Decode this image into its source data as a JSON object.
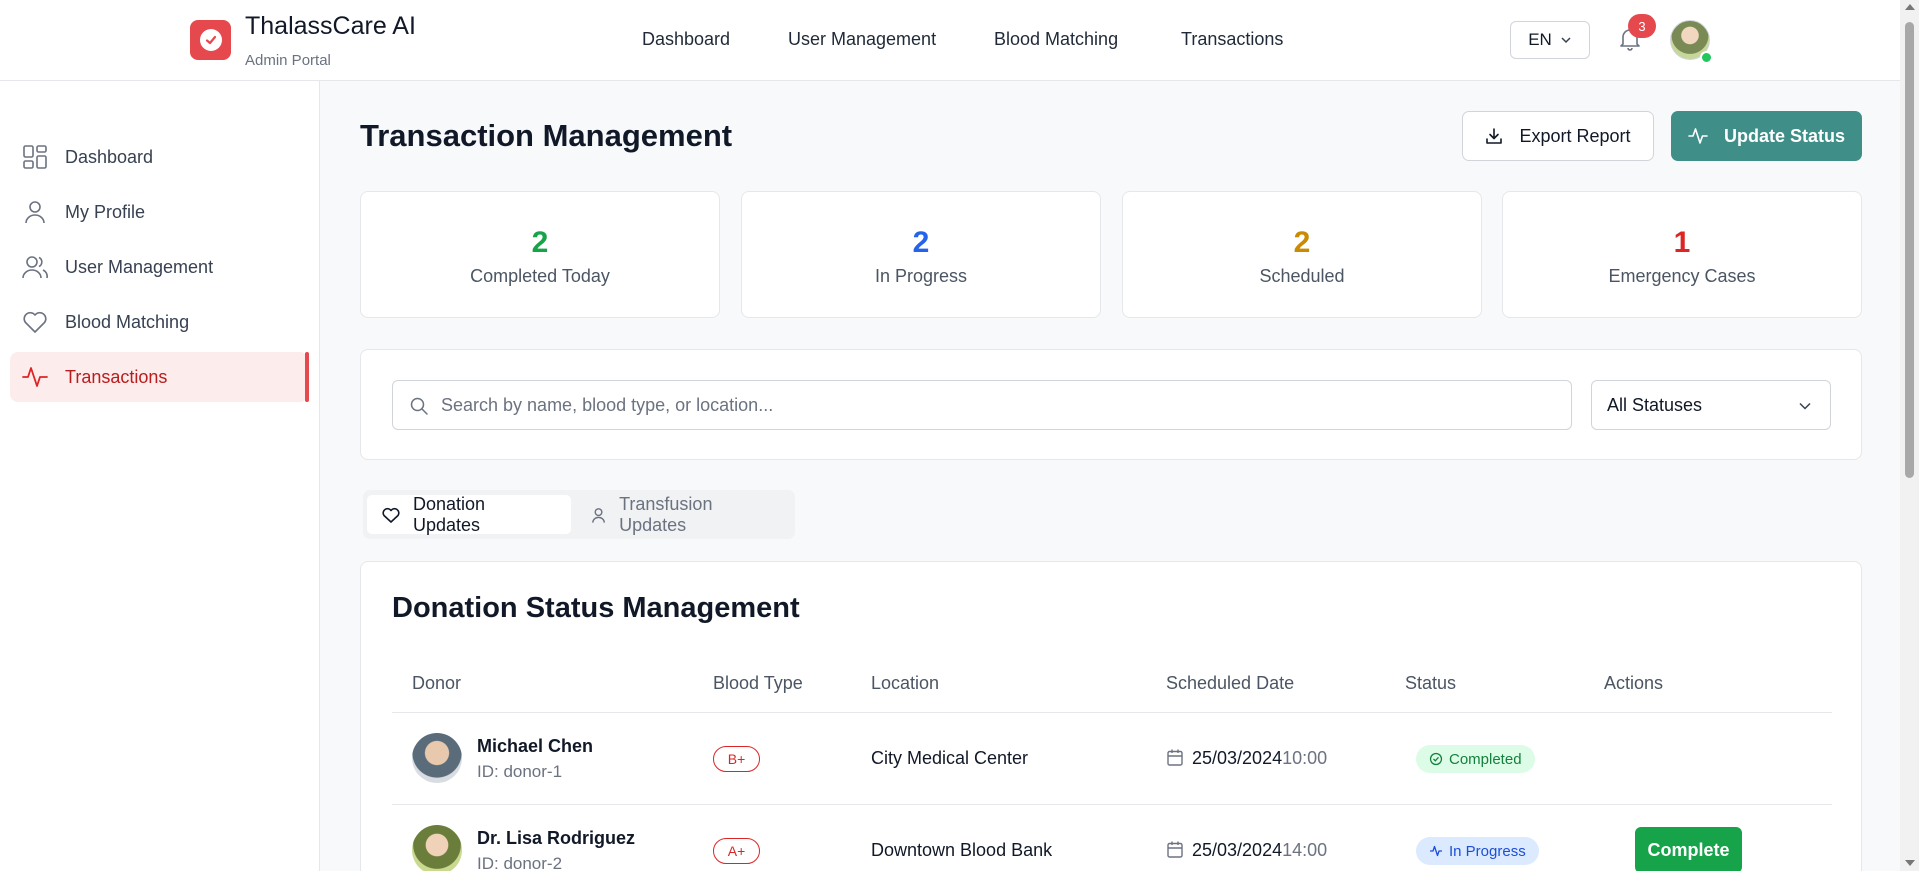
{
  "brand": {
    "title": "ThalassCare AI",
    "subtitle": "Admin Portal",
    "accent": "#e5484d"
  },
  "topnav": {
    "items": [
      {
        "label": "Dashboard"
      },
      {
        "label": "User Management"
      },
      {
        "label": "Blood Matching"
      },
      {
        "label": "Transactions"
      }
    ],
    "language": "EN",
    "notifications_count": "3"
  },
  "sidebar": {
    "items": [
      {
        "label": "Dashboard",
        "icon": "grid-icon"
      },
      {
        "label": "My Profile",
        "icon": "user-icon"
      },
      {
        "label": "User Management",
        "icon": "users-icon"
      },
      {
        "label": "Blood Matching",
        "icon": "heart-icon"
      },
      {
        "label": "Transactions",
        "icon": "activity-icon",
        "active": true
      }
    ]
  },
  "page": {
    "title": "Transaction Management",
    "export_label": "Export Report",
    "update_label": "Update Status",
    "primary_color": "#3f8f88"
  },
  "stats": [
    {
      "value": "2",
      "label": "Completed Today",
      "color": "#16a34a"
    },
    {
      "value": "2",
      "label": "In Progress",
      "color": "#2563eb"
    },
    {
      "value": "2",
      "label": "Scheduled",
      "color": "#ca8a04"
    },
    {
      "value": "1",
      "label": "Emergency Cases",
      "color": "#dc2626"
    }
  ],
  "filters": {
    "search_placeholder": "Search by name, blood type, or location...",
    "search_value": "",
    "status_selected": "All Statuses"
  },
  "tabs": [
    {
      "label": "Donation Updates",
      "active": true
    },
    {
      "label": "Transfusion Updates",
      "active": false
    }
  ],
  "table": {
    "title": "Donation Status Management",
    "columns": [
      "Donor",
      "Blood Type",
      "Location",
      "Scheduled Date",
      "Status",
      "Actions"
    ],
    "rows": [
      {
        "name": "Michael Chen",
        "id": "ID: donor-1",
        "blood_type": "B+",
        "location": "City Medical Center",
        "date": "25/03/2024",
        "time": "10:00",
        "status": "Completed",
        "action": ""
      },
      {
        "name": "Dr. Lisa Rodriguez",
        "id": "ID: donor-2",
        "blood_type": "A+",
        "location": "Downtown Blood Bank",
        "date": "25/03/2024",
        "time": "14:00",
        "status": "In Progress",
        "action": "Complete"
      }
    ]
  }
}
